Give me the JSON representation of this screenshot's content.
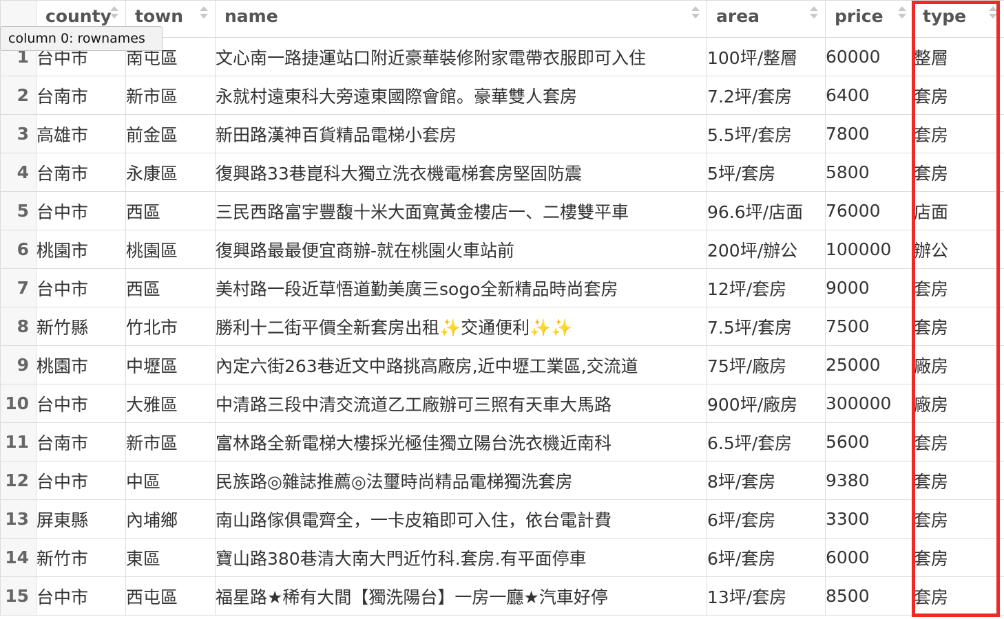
{
  "tooltip": "column 0: rownames",
  "columns": [
    "county",
    "town",
    "name",
    "area",
    "price",
    "type"
  ],
  "rows": [
    {
      "rowname": "1",
      "county": "台中市",
      "town": "南屯區",
      "name": "文心南一路捷運站口附近豪華裝修附家電帶衣服即可入住",
      "area": "100坪/整層",
      "price": "60000",
      "type": "整層"
    },
    {
      "rowname": "2",
      "county": "台南市",
      "town": "新市區",
      "name": "永就村遠東科大旁遠東國際會館。豪華雙人套房",
      "area": "7.2坪/套房",
      "price": "6400",
      "type": "套房"
    },
    {
      "rowname": "3",
      "county": "高雄市",
      "town": "前金區",
      "name": "新田路漢神百貨精品電梯小套房",
      "area": "5.5坪/套房",
      "price": "7800",
      "type": "套房"
    },
    {
      "rowname": "4",
      "county": "台南市",
      "town": "永康區",
      "name": "復興路33巷崑科大獨立洗衣機電梯套房堅固防震",
      "area": "5坪/套房",
      "price": "5800",
      "type": "套房"
    },
    {
      "rowname": "5",
      "county": "台中市",
      "town": "西區",
      "name": "三民西路富宇豐馥十米大面寬黃金樓店一、二樓雙平車",
      "area": "96.6坪/店面",
      "price": "76000",
      "type": "店面"
    },
    {
      "rowname": "6",
      "county": "桃園市",
      "town": "桃園區",
      "name": "復興路最最便宜商辦-就在桃園火車站前",
      "area": "200坪/辦公",
      "price": "100000",
      "type": "辦公"
    },
    {
      "rowname": "7",
      "county": "台中市",
      "town": "西區",
      "name": "美村路一段近草悟道勤美廣三sogo全新精品時尚套房",
      "area": "12坪/套房",
      "price": "9000",
      "type": "套房"
    },
    {
      "rowname": "8",
      "county": "新竹縣",
      "town": "竹北市",
      "name": "勝利十二街平價全新套房出租✨交通便利✨✨",
      "area": "7.5坪/套房",
      "price": "7500",
      "type": "套房"
    },
    {
      "rowname": "9",
      "county": "桃園市",
      "town": "中壢區",
      "name": "內定六街263巷近文中路挑高廠房,近中壢工業區,交流道",
      "area": "75坪/廠房",
      "price": "25000",
      "type": "廠房"
    },
    {
      "rowname": "10",
      "county": "台中市",
      "town": "大雅區",
      "name": "中清路三段中清交流道乙工廠辦可三照有天車大馬路",
      "area": "900坪/廠房",
      "price": "300000",
      "type": "廠房"
    },
    {
      "rowname": "11",
      "county": "台南市",
      "town": "新市區",
      "name": "富林路全新電梯大樓採光極佳獨立陽台洗衣機近南科",
      "area": "6.5坪/套房",
      "price": "5600",
      "type": "套房"
    },
    {
      "rowname": "12",
      "county": "台中市",
      "town": "中區",
      "name": "民族路◎雜誌推薦◎法璽時尚精品電梯獨洗套房",
      "area": "8坪/套房",
      "price": "9380",
      "type": "套房"
    },
    {
      "rowname": "13",
      "county": "屏東縣",
      "town": "內埔鄉",
      "name": "南山路傢俱電齊全，一卡皮箱即可入住，依台電計費",
      "area": "6坪/套房",
      "price": "3300",
      "type": "套房"
    },
    {
      "rowname": "14",
      "county": "新竹市",
      "town": "東區",
      "name": "寶山路380巷清大南大門近竹科.套房.有平面停車",
      "area": "6坪/套房",
      "price": "6000",
      "type": "套房"
    },
    {
      "rowname": "15",
      "county": "台中市",
      "town": "西屯區",
      "name": "福星路★稀有大間【獨洗陽台】一房一廳★汽車好停",
      "area": "13坪/套房",
      "price": "8500",
      "type": "套房"
    }
  ]
}
